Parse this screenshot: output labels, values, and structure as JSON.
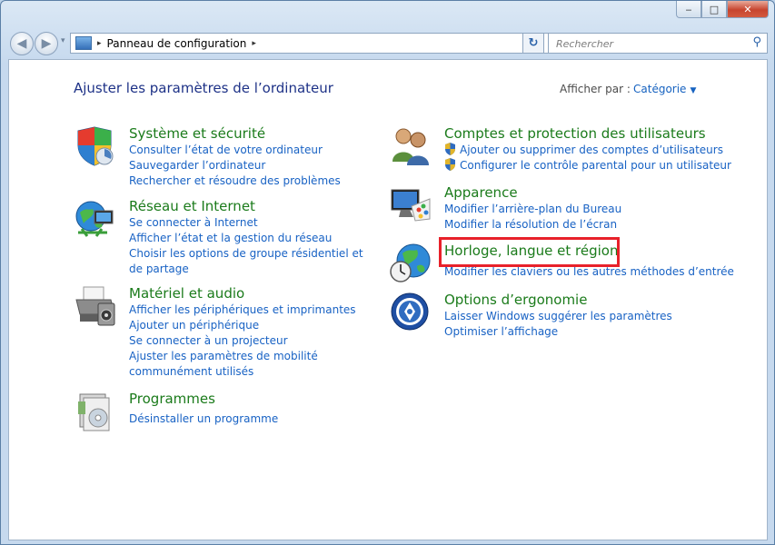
{
  "window": {
    "minimize_glyph": "‒",
    "maximize_glyph": "□",
    "close_glyph": "✕"
  },
  "nav": {
    "back_glyph": "◀",
    "forward_glyph": "▶",
    "recent_glyph": "▾",
    "address_sep": "▸",
    "address": "Panneau de configuration",
    "address_trail": "▸",
    "address_dropdown": "▼",
    "refresh_glyph": "↻",
    "search_placeholder": "Rechercher",
    "search_glyph": "⚲"
  },
  "page": {
    "heading": "Ajuster les paramètres de l’ordinateur",
    "view_by_label": "Afficher par :",
    "view_by_value": "Catégorie",
    "view_by_caret": "▼"
  },
  "categories": {
    "system": {
      "title": "Système et sécurité",
      "icon": "shield-icon",
      "links": [
        "Consulter l’état de votre ordinateur",
        "Sauvegarder l’ordinateur",
        "Rechercher et résoudre des problèmes"
      ]
    },
    "network": {
      "title": "Réseau et Internet",
      "icon": "network-globe-icon",
      "links": [
        "Se connecter à Internet",
        "Afficher l’état et la gestion du réseau",
        "Choisir les options de groupe résidentiel et de partage"
      ]
    },
    "hardware": {
      "title": "Matériel et audio",
      "icon": "printer-icon",
      "links": [
        "Afficher les périphériques et imprimantes",
        "Ajouter un périphérique",
        "Se connecter à un projecteur",
        "Ajuster les paramètres de mobilité communément utilisés"
      ]
    },
    "programs": {
      "title": "Programmes",
      "icon": "programs-icon",
      "links": [
        "Désinstaller un programme"
      ]
    },
    "accounts": {
      "title": "Comptes et protection des utilisateurs",
      "icon": "users-icon",
      "links": [
        "Ajouter ou supprimer des comptes d’utilisateurs",
        "Configurer le contrôle parental pour un utilisateur"
      ]
    },
    "appearance": {
      "title": "Apparence",
      "icon": "display-palette-icon",
      "links": [
        "Modifier l’arrière-plan du Bureau",
        "Modifier la résolution de l’écran"
      ]
    },
    "clock": {
      "title": "Horloge, langue et région",
      "icon": "clock-globe-icon",
      "links": [
        "Modifier les claviers ou les autres méthodes d’entrée"
      ]
    },
    "ease": {
      "title": "Options d’ergonomie",
      "icon": "ease-of-access-icon",
      "links": [
        "Laisser Windows suggérer les paramètres",
        "Optimiser l’affichage"
      ]
    }
  },
  "colors": {
    "title_green": "#1b7b1b",
    "link_blue": "#1862c4",
    "heading_blue": "#1e3287",
    "highlight_red": "#e8212a"
  }
}
